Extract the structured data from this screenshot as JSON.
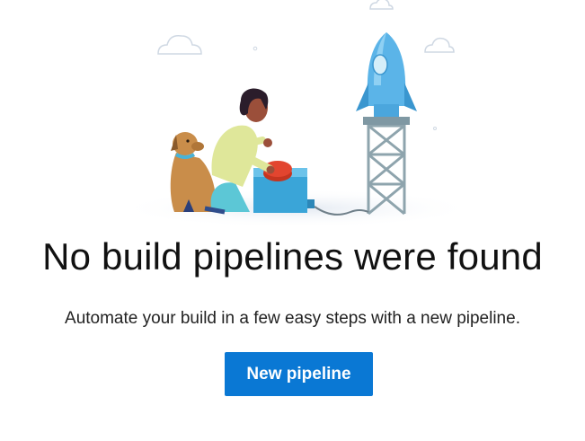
{
  "empty_state": {
    "title": "No build pipelines were found",
    "description": "Automate your build in a few easy steps with a new pipeline.",
    "button_label": "New pipeline"
  },
  "colors": {
    "primary_button": "#0a78d4",
    "rocket": "#5bb4e8",
    "tower": "#8ea4ad",
    "box": "#3aa5d8",
    "dog": "#c98d4a",
    "person_shirt": "#dfe79a",
    "person_pants": "#5cc7d6",
    "red_button": "#e2452f"
  },
  "illustration": {
    "icon": "rocket-launch-illustration"
  }
}
